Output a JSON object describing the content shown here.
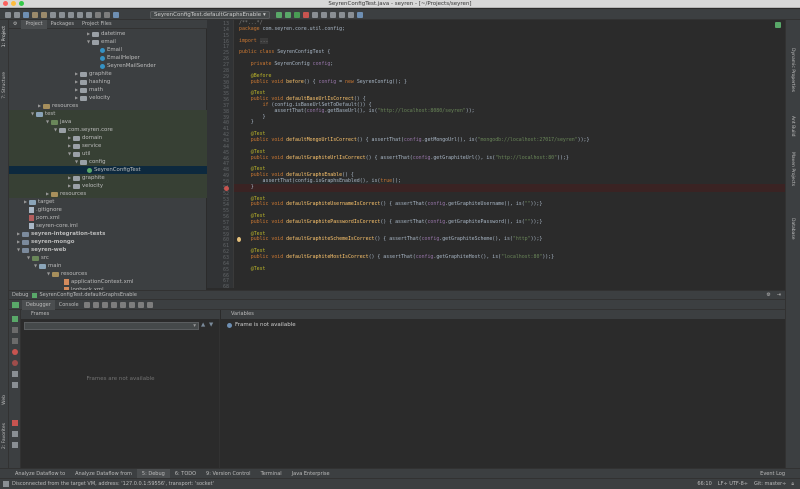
{
  "window": {
    "title": "SeyrenConfigTest.java - seyren - [~/Projects/seyren]",
    "traffic_lights": [
      "#fc615d",
      "#fdbc40",
      "#34c84a"
    ]
  },
  "toolbar": {
    "run_config": "SeyrenConfigTest.defaultGraphsEnable"
  },
  "left_stripe": {
    "tabs": [
      "1: Project",
      "7: Structure",
      "2: Favorites",
      "Web"
    ]
  },
  "right_stripe": {
    "tabs": [
      "Dynamic Properties",
      "Ant Build",
      "Maven Projects",
      "Database"
    ]
  },
  "project_panel": {
    "tabs": [
      "Project",
      "Packages",
      "Project Files"
    ],
    "tree": [
      {
        "label": "datetime",
        "icon": "package-folder"
      },
      {
        "label": "email",
        "icon": "package-folder"
      },
      {
        "label": "Email",
        "icon": "java-class"
      },
      {
        "label": "EmailHelper",
        "icon": "java-class"
      },
      {
        "label": "SeyrenMailSender",
        "icon": "java-class"
      },
      {
        "label": "graphite",
        "icon": "package-folder"
      },
      {
        "label": "hashing",
        "icon": "package-folder"
      },
      {
        "label": "math",
        "icon": "package-folder"
      },
      {
        "label": "velocity",
        "icon": "package-folder"
      },
      {
        "label": "resources",
        "icon": "resources-folder"
      },
      {
        "label": "test",
        "icon": "folder"
      },
      {
        "label": "java",
        "icon": "test-source-folder"
      },
      {
        "label": "com.seyren.core",
        "icon": "package-folder"
      },
      {
        "label": "domain",
        "icon": "package-folder"
      },
      {
        "label": "service",
        "icon": "package-folder"
      },
      {
        "label": "util",
        "icon": "package-folder"
      },
      {
        "label": "config",
        "icon": "package-folder"
      },
      {
        "label": "SeyrenConfigTest",
        "icon": "java-test-class"
      },
      {
        "label": "graphite",
        "icon": "package-folder"
      },
      {
        "label": "velocity",
        "icon": "package-folder"
      },
      {
        "label": "resources",
        "icon": "resources-folder"
      },
      {
        "label": "target",
        "icon": "folder"
      },
      {
        "label": ".gitignore",
        "icon": "file"
      },
      {
        "label": "pom.xml",
        "icon": "maven-file"
      },
      {
        "label": "seyren-core.iml",
        "icon": "file"
      },
      {
        "label": "seyren-integration-tests",
        "icon": "module-folder"
      },
      {
        "label": "seyren-mongo",
        "icon": "module-folder"
      },
      {
        "label": "seyren-web",
        "icon": "module-folder"
      },
      {
        "label": "src",
        "icon": "source-folder"
      },
      {
        "label": "main",
        "icon": "folder"
      },
      {
        "label": "resources",
        "icon": "resources-folder"
      },
      {
        "label": "applicationContext.xml",
        "icon": "xml-file"
      },
      {
        "label": "logback.xml",
        "icon": "xml-file"
      }
    ]
  },
  "editor": {
    "line_numbers": [
      "13",
      "14",
      "15",
      "16",
      "17",
      "25",
      "26",
      "27",
      "28",
      "29",
      "30",
      "34",
      "35",
      "36",
      "37",
      "38",
      "39",
      "40",
      "41",
      "42",
      "43",
      "44",
      "45",
      "46",
      "47",
      "48",
      "49",
      "50",
      "51",
      "52",
      "53",
      "54",
      "55",
      "56",
      "57",
      "58",
      "59",
      "60",
      "61",
      "62",
      "63",
      "64",
      "65",
      "66",
      "67",
      "68",
      "69",
      "70",
      "71",
      "72",
      "73",
      "74",
      "75",
      "76"
    ],
    "lines": [
      {
        "parts": [
          [
            "cm",
            "/**...*/"
          ]
        ]
      },
      {
        "parts": [
          [
            "kw",
            "package "
          ],
          [
            "",
            "com.seyren.core.util.config;"
          ]
        ]
      },
      {
        "parts": [
          [
            "",
            ""
          ]
        ]
      },
      {
        "parts": [
          [
            "kw",
            "import "
          ],
          [
            "fold",
            "..."
          ]
        ]
      },
      {
        "parts": [
          [
            "",
            ""
          ]
        ]
      },
      {
        "parts": [
          [
            "kw",
            "public class "
          ],
          [
            "",
            "SeyrenConfigTest {"
          ]
        ]
      },
      {
        "parts": [
          [
            "",
            ""
          ]
        ]
      },
      {
        "parts": [
          [
            "",
            "    "
          ],
          [
            "kw",
            "private "
          ],
          [
            "",
            "SeyrenConfig "
          ],
          [
            "fld",
            "config"
          ],
          [
            "",
            ";"
          ]
        ]
      },
      {
        "parts": [
          [
            "",
            ""
          ]
        ]
      },
      {
        "parts": [
          [
            "ann",
            "    @Before"
          ]
        ]
      },
      {
        "parts": [
          [
            "",
            "    "
          ],
          [
            "kw",
            "public void "
          ],
          [
            "fn",
            "before"
          ],
          [
            "",
            "() { "
          ],
          [
            "fld",
            "config"
          ],
          [
            "",
            " = "
          ],
          [
            "kw",
            "new "
          ],
          [
            "",
            "SeyrenConfig(); }"
          ]
        ]
      },
      {
        "parts": [
          [
            "",
            ""
          ]
        ]
      },
      {
        "parts": [
          [
            "ann",
            "    @Test"
          ]
        ]
      },
      {
        "parts": [
          [
            "",
            "    "
          ],
          [
            "kw",
            "public void "
          ],
          [
            "fn",
            "defaultBaseUrlIsCorrect"
          ],
          [
            "",
            "() {"
          ]
        ]
      },
      {
        "parts": [
          [
            "",
            "        "
          ],
          [
            "kw",
            "if "
          ],
          [
            "",
            "(config.isBaseUrlSetToDefault()) {"
          ]
        ]
      },
      {
        "parts": [
          [
            "",
            "            assertThat("
          ],
          [
            "fld",
            "config"
          ],
          [
            "",
            ".getBaseUrl(), is("
          ],
          [
            "str",
            "\"http://localhost:8080/seyren\""
          ],
          [
            "",
            "));"
          ]
        ]
      },
      {
        "parts": [
          [
            "",
            "        }"
          ]
        ]
      },
      {
        "parts": [
          [
            "",
            "    }"
          ]
        ]
      },
      {
        "parts": [
          [
            "",
            ""
          ]
        ]
      },
      {
        "parts": [
          [
            "ann",
            "    @Test"
          ]
        ]
      },
      {
        "parts": [
          [
            "",
            "    "
          ],
          [
            "kw",
            "public void "
          ],
          [
            "fn",
            "defaultMongoUrlIsCorrect"
          ],
          [
            "",
            "() { assertThat("
          ],
          [
            "fld",
            "config"
          ],
          [
            "",
            ".getMongoUrl(), is("
          ],
          [
            "str",
            "\"mongodb://localhost:27017/seyren\""
          ],
          [
            "",
            "));}"
          ]
        ]
      },
      {
        "parts": [
          [
            "",
            ""
          ]
        ]
      },
      {
        "parts": [
          [
            "ann",
            "    @Test"
          ]
        ]
      },
      {
        "parts": [
          [
            "",
            "    "
          ],
          [
            "kw",
            "public void "
          ],
          [
            "fn",
            "defaultGraphiteUrlIsCorrect"
          ],
          [
            "",
            "() { assertThat("
          ],
          [
            "fld",
            "config"
          ],
          [
            "",
            ".getGraphiteUrl(), is("
          ],
          [
            "str",
            "\"http://localhost:80\""
          ],
          [
            "",
            "));}"
          ]
        ]
      },
      {
        "parts": [
          [
            "",
            ""
          ]
        ]
      },
      {
        "parts": [
          [
            "ann",
            "    @Test"
          ]
        ]
      },
      {
        "parts": [
          [
            "",
            "    "
          ],
          [
            "kw",
            "public void "
          ],
          [
            "fn",
            "defaultGraphsEnable"
          ],
          [
            "",
            "() {"
          ]
        ]
      },
      {
        "parts": [
          [
            "",
            "        assertThat(config.isGraphsEnabled(), is("
          ],
          [
            "kw",
            "true"
          ],
          [
            "",
            "));"
          ]
        ]
      },
      {
        "parts": [
          [
            "",
            "    }"
          ]
        ]
      },
      {
        "parts": [
          [
            "",
            ""
          ]
        ]
      },
      {
        "parts": [
          [
            "ann",
            "    @Test"
          ]
        ]
      },
      {
        "parts": [
          [
            "",
            "    "
          ],
          [
            "kw",
            "public void "
          ],
          [
            "fn",
            "defaultGraphiteUsernameIsCorrect"
          ],
          [
            "",
            "() { assertThat("
          ],
          [
            "fld",
            "config"
          ],
          [
            "",
            ".getGraphiteUsername(), is("
          ],
          [
            "str",
            "\"\""
          ],
          [
            "",
            "));}"
          ]
        ]
      },
      {
        "parts": [
          [
            "",
            ""
          ]
        ]
      },
      {
        "parts": [
          [
            "ann",
            "    @Test"
          ]
        ]
      },
      {
        "parts": [
          [
            "",
            "    "
          ],
          [
            "kw",
            "public void "
          ],
          [
            "fn",
            "defaultGraphitePasswordIsCorrect"
          ],
          [
            "",
            "() { assertThat("
          ],
          [
            "fld",
            "config"
          ],
          [
            "",
            ".getGraphitePassword(), is("
          ],
          [
            "str",
            "\"\""
          ],
          [
            "",
            "));}"
          ]
        ]
      },
      {
        "parts": [
          [
            "",
            ""
          ]
        ]
      },
      {
        "parts": [
          [
            "ann",
            "    @Test"
          ]
        ]
      },
      {
        "parts": [
          [
            "",
            "    "
          ],
          [
            "kw",
            "public void "
          ],
          [
            "fn",
            "defaultGraphiteSchemeIsCorrect"
          ],
          [
            "",
            "() { assertThat("
          ],
          [
            "fld",
            "config"
          ],
          [
            "",
            ".getGraphiteScheme(), is("
          ],
          [
            "str",
            "\"http\""
          ],
          [
            "",
            "));}"
          ]
        ]
      },
      {
        "parts": [
          [
            "",
            ""
          ]
        ]
      },
      {
        "parts": [
          [
            "ann",
            "    @Test"
          ]
        ]
      },
      {
        "parts": [
          [
            "",
            "    "
          ],
          [
            "kw",
            "public void "
          ],
          [
            "fn",
            "defaultGraphiteHostIsCorrect"
          ],
          [
            "",
            "() { assertThat("
          ],
          [
            "fld",
            "config"
          ],
          [
            "",
            ".getGraphiteHost(), is("
          ],
          [
            "str",
            "\"localhost:80\""
          ],
          [
            "",
            "));}"
          ]
        ]
      },
      {
        "parts": [
          [
            "",
            ""
          ]
        ]
      },
      {
        "parts": [
          [
            "ann",
            "    @Test"
          ]
        ]
      }
    ]
  },
  "debug": {
    "title": "Debug",
    "config": "SeyrenConfigTest.defaultGraphsEnable",
    "tabs": [
      "Debugger",
      "Console"
    ],
    "frames_header": "Frames",
    "frames_empty": "Frames are not available",
    "variables_header": "Variables",
    "variables_message": "Frame is not available"
  },
  "bottom_tools": {
    "left": [
      "Analyze Dataflow to",
      "Analyze Dataflow from",
      "5: Debug",
      "6: TODO",
      "9: Version Control",
      "Terminal",
      "Java Enterprise"
    ],
    "right": "Event Log"
  },
  "status": {
    "message": "Disconnected from the target VM, address: '127.0.0.1:59556', transport: 'socket'",
    "position": "66:10",
    "encoding": "LF÷ UTF-8÷",
    "vcs": "Git: master÷"
  },
  "colors": {
    "background": "#2b2b2b",
    "panel": "#3c3f41",
    "selection": "#0d293e",
    "keyword": "#cc7832",
    "string": "#6a8759",
    "annotation": "#bbb529",
    "method": "#ffc66d",
    "field": "#9876aa",
    "breakpoint": "#c75450"
  }
}
